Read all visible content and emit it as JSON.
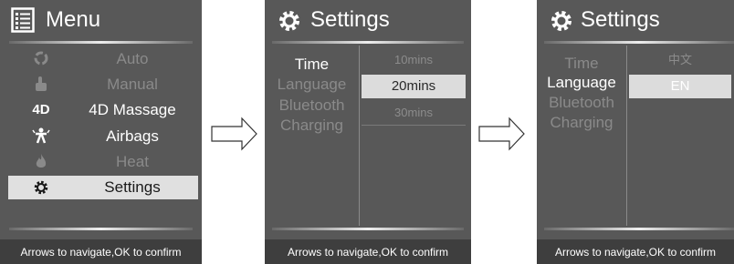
{
  "screen1": {
    "title": "Menu",
    "items": [
      {
        "label": "Auto",
        "icon": "auto-icon",
        "state": "dim"
      },
      {
        "label": "Manual",
        "icon": "hand-icon",
        "state": "dim"
      },
      {
        "label": "4D Massage",
        "icon": "4d-icon",
        "icon_text": "4D",
        "state": "bright"
      },
      {
        "label": "Airbags",
        "icon": "airbag-icon",
        "state": "bright"
      },
      {
        "label": "Heat",
        "icon": "flame-icon",
        "state": "dim"
      },
      {
        "label": "Settings",
        "icon": "gear-icon",
        "state": "selected"
      }
    ],
    "footer": "Arrows to navigate,OK to confirm"
  },
  "screen2": {
    "title": "Settings",
    "items": [
      "Time",
      "Language",
      "Bluetooth",
      "Charging"
    ],
    "options": [
      "10mins",
      "20mins",
      "30mins"
    ],
    "selected_option": "20mins",
    "footer": "Arrows to navigate,OK to confirm"
  },
  "screen3": {
    "title": "Settings",
    "items": [
      "Time",
      "Language",
      "Bluetooth",
      "Charging"
    ],
    "options": [
      "中文",
      "EN"
    ],
    "selected_option": "EN",
    "footer": "Arrows to navigate,OK to confirm"
  },
  "colors": {
    "panel": "#585858",
    "footer": "#3e3e3e",
    "highlight": "#e0e0e0"
  }
}
